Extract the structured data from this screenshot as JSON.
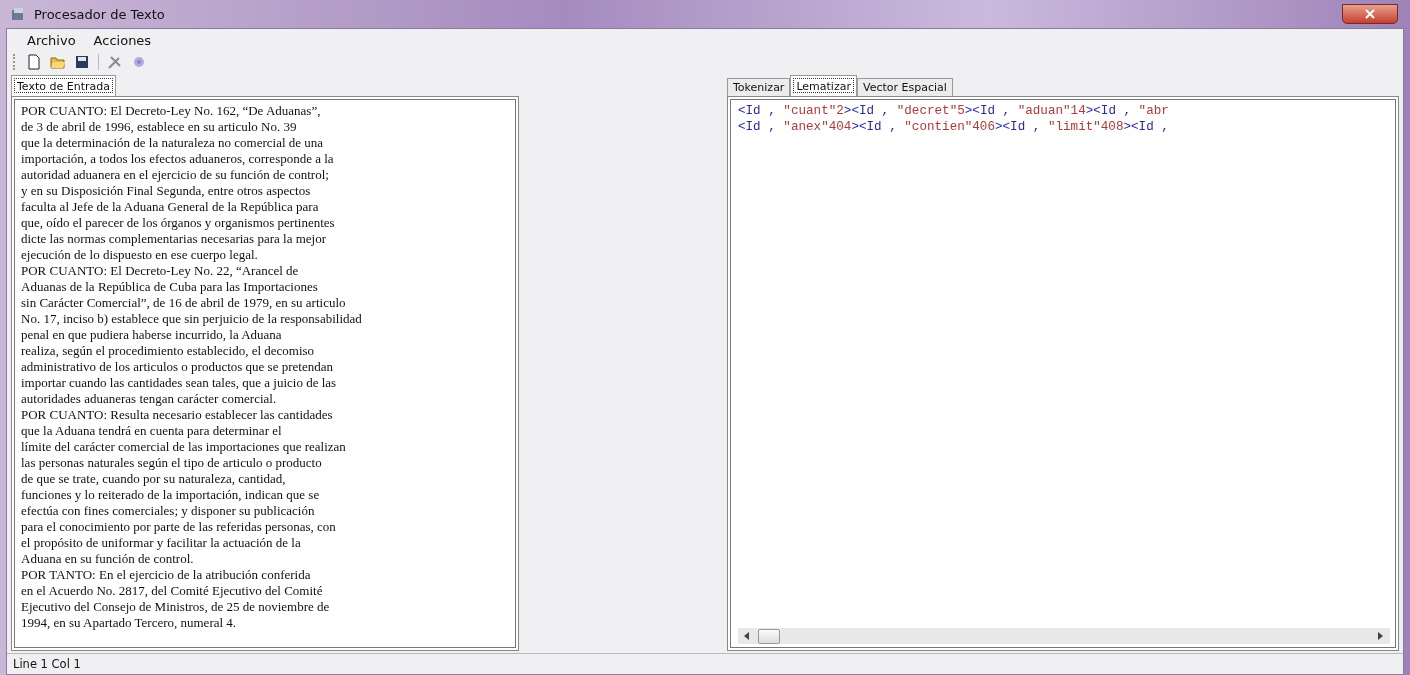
{
  "window": {
    "title": "Procesador de Texto"
  },
  "menu": [
    "Archivo",
    "Acciones"
  ],
  "left_tabs": [
    {
      "label": "Texto de Entrada",
      "selected": true
    }
  ],
  "input_text": [
    "POR CUANTO: El Decreto-Ley No. 162, “De Aduanas”,",
    "de 3 de abril de 1996, establece en su articulo No. 39",
    "que la determinación de la naturaleza no comercial de una",
    "importación, a todos los efectos aduaneros, corresponde a la",
    "autoridad aduanera en el ejercicio de su función de control;",
    "y en su Disposición Final Segunda, entre otros aspectos",
    "faculta al Jefe de la Aduana General de la República para",
    "que, oído el parecer de los órganos y organismos pertinentes",
    "dicte las normas complementarias necesarias para la mejor",
    "ejecución de lo dispuesto en ese cuerpo legal.",
    "POR CUANTO: El Decreto-Ley No. 22, “Arancel de",
    "Aduanas de la República de Cuba para las Importaciones",
    "sin Carácter Comercial”, de 16 de abril de 1979, en su articulo",
    "No. 17, inciso b) establece que sin perjuicio de la responsabilidad",
    "penal en que pudiera haberse incurrido, la Aduana",
    "realiza, según el procedimiento establecido, el decomiso",
    "administrativo de los articulos o productos que se pretendan",
    "importar cuando las cantidades sean tales, que a juicio de las",
    "autoridades aduaneras tengan carácter comercial.",
    "POR CUANTO: Resulta necesario establecer las cantidades",
    "que la Aduana tendrá en cuenta para determinar el",
    "límite del carácter comercial de las importaciones que realizan",
    "las personas naturales según el tipo de articulo o producto",
    "de que se trate, cuando por su naturaleza, cantidad,",
    "funciones y lo reiterado de la importación, indican que se",
    "efectúa con fines comerciales; y disponer su publicación",
    "para el conocimiento por parte de las referidas personas, con",
    "el propósito de uniformar y facilitar la actuación de la",
    "Aduana en su función de control.",
    "POR TANTO: En el ejercicio de la atribución conferida",
    "en el Acuerdo No. 2817, del Comité Ejecutivo del Comité",
    "Ejecutivo del Consejo de Ministros, de 25 de noviembre de",
    "1994, en su Apartado Tercero, numeral 4."
  ],
  "right_tabs": [
    {
      "label": "Tokenizar",
      "selected": false
    },
    {
      "label": "Lematizar",
      "selected": true
    },
    {
      "label": "Vector Espacial",
      "selected": false
    }
  ],
  "output_lines": [
    [
      {
        "kind": "tag",
        "text": "<Id , "
      },
      {
        "kind": "str",
        "text": "\"cuant\"2"
      },
      {
        "kind": "tag",
        "text": "><Id , "
      },
      {
        "kind": "str",
        "text": "\"decret\"5"
      },
      {
        "kind": "tag",
        "text": "><Id , "
      },
      {
        "kind": "str",
        "text": "\"aduan\"14"
      },
      {
        "kind": "tag",
        "text": "><Id , "
      },
      {
        "kind": "str",
        "text": "\"abr"
      }
    ],
    [
      {
        "kind": "tag",
        "text": "<Id , "
      },
      {
        "kind": "str",
        "text": "\"anex\"404"
      },
      {
        "kind": "tag",
        "text": "><Id , "
      },
      {
        "kind": "str",
        "text": "\"contien\"406"
      },
      {
        "kind": "tag",
        "text": "><Id , "
      },
      {
        "kind": "str",
        "text": "\"limit\"408"
      },
      {
        "kind": "tag",
        "text": "><Id ,"
      }
    ]
  ],
  "status_bar": "Line 1 Col 1"
}
